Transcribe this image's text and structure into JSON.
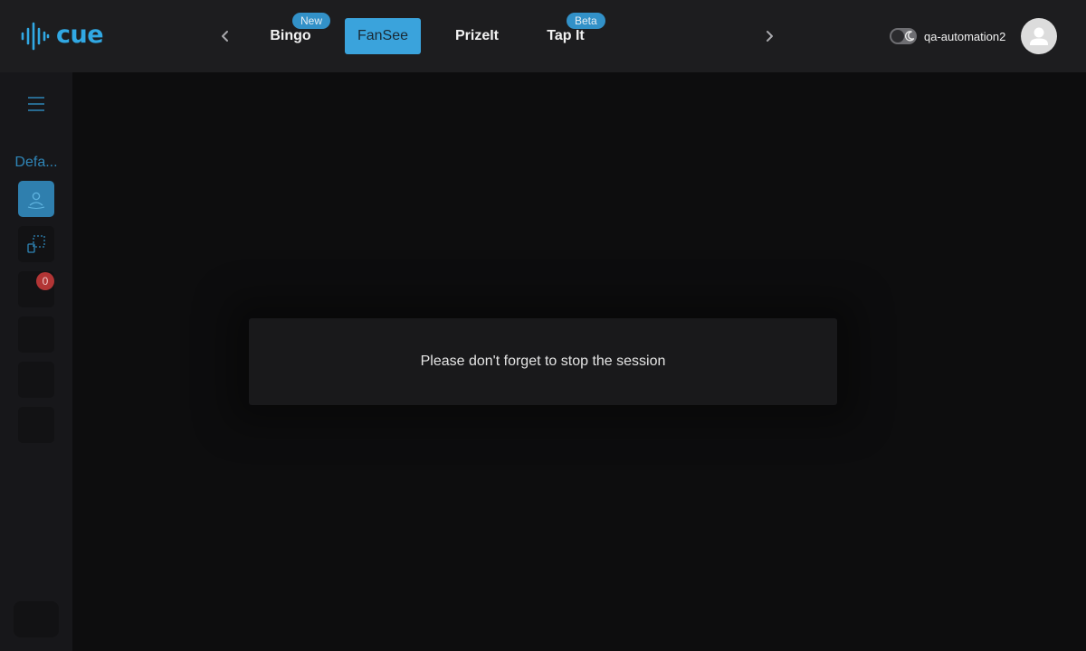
{
  "app": {
    "logo_text": "cue"
  },
  "header": {
    "tabs": [
      {
        "label": "Bingo",
        "badge": "New",
        "active": false
      },
      {
        "label": "FanSee",
        "badge": "",
        "active": true
      },
      {
        "label": "PrizeIt",
        "badge": "",
        "active": false
      },
      {
        "label": "Tap It",
        "badge": "Beta",
        "active": false
      }
    ],
    "username": "qa-automation2",
    "prev_icon": "chevron-left-icon",
    "next_icon": "chevron-right-icon",
    "theme_icon": "moon-icon"
  },
  "sidebar": {
    "title": "Defa...",
    "notification_count": "0",
    "items": [
      {
        "icon": "user-broadcast-icon",
        "active": true
      },
      {
        "icon": "screen-select-icon",
        "active": false
      },
      {
        "icon": "notification-item",
        "active": false
      },
      {
        "icon": "blank-item",
        "active": false
      },
      {
        "icon": "blank-item",
        "active": false
      },
      {
        "icon": "blank-item",
        "active": false
      }
    ]
  },
  "modal": {
    "message": "Please don't forget to stop the session"
  },
  "colors": {
    "accent": "#3aa3dc",
    "header_bg": "#1d1d1f",
    "sidebar_bg": "#17171a",
    "main_bg": "#0d0d0e",
    "badge_red": "#b23535"
  }
}
